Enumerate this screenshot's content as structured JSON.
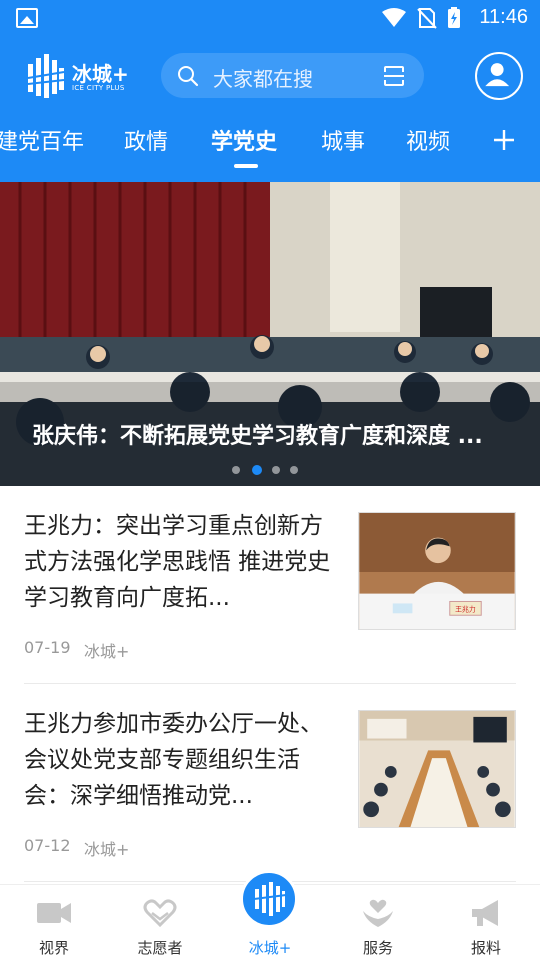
{
  "status_bar": {
    "time": "11:46"
  },
  "header": {
    "logo_name": "冰城+",
    "logo_sub": "ICE CITY PLUS",
    "search_placeholder": "大家都在搜"
  },
  "tabs": [
    {
      "label": "建党百年"
    },
    {
      "label": "政情"
    },
    {
      "label": "学党史",
      "active": true
    },
    {
      "label": "城事"
    },
    {
      "label": "视频"
    }
  ],
  "banner": {
    "title": "张庆伟：不断拓展党史学习教育广度和深度 ...",
    "dot_count": 4,
    "active_dot": 1
  },
  "news": [
    {
      "title": "王兆力：突出学习重点创新方式方法强化学思践悟 推进党史学习教育向广度拓...",
      "date": "07-19",
      "source": "冰城+",
      "nameplate": "王兆力"
    },
    {
      "title": "王兆力参加市委办公厅一处、会议处党支部专题组织生活会：深学细悟推动党...",
      "date": "07-12",
      "source": "冰城+"
    }
  ],
  "bottom_nav": [
    {
      "label": "视界",
      "icon": "video-camera-icon"
    },
    {
      "label": "志愿者",
      "icon": "heart-hands-icon"
    },
    {
      "label": "冰城+",
      "icon": "ice-city-logo-icon",
      "active": true
    },
    {
      "label": "服务",
      "icon": "service-hands-icon"
    },
    {
      "label": "报料",
      "icon": "megaphone-icon"
    }
  ],
  "colors": {
    "primary": "#1d8af6",
    "search_bg": "#3d9bf8",
    "nav_inactive": "#c8c8c8"
  }
}
